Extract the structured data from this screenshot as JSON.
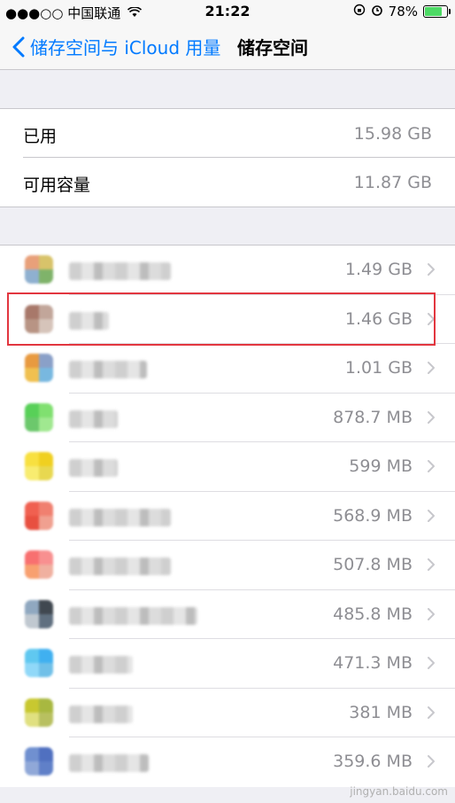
{
  "status_bar": {
    "carrier": "●●●○○ 中国联通",
    "time": "21:22",
    "battery": "78%",
    "battery_level": 0.78
  },
  "nav": {
    "back_label": "储存空间与 iCloud 用量",
    "title": "储存空间"
  },
  "storage_summary": [
    {
      "label": "已用",
      "value": "15.98 GB"
    },
    {
      "label": "可用容量",
      "value": "11.87 GB"
    }
  ],
  "apps": [
    {
      "size": "1.49 GB",
      "colors": [
        "#e8a07a",
        "#d8c36a",
        "#8fb0d0",
        "#7fb36a"
      ]
    },
    {
      "size": "1.46 GB",
      "colors": [
        "#a8786a",
        "#c2a69a",
        "#b89484",
        "#d6c4ba"
      ]
    },
    {
      "size": "1.01 GB",
      "colors": [
        "#e89a40",
        "#8aa0c8",
        "#f0c050",
        "#78b8e0"
      ]
    },
    {
      "size": "878.7 MB",
      "colors": [
        "#58d058",
        "#80e070",
        "#6cc86c",
        "#a0e890"
      ]
    },
    {
      "size": "599 MB",
      "colors": [
        "#f8e040",
        "#f0d020",
        "#f8ec70",
        "#e8d850"
      ]
    },
    {
      "size": "568.9 MB",
      "colors": [
        "#f06050",
        "#f08070",
        "#e85040",
        "#f0a090"
      ]
    },
    {
      "size": "507.8 MB",
      "colors": [
        "#f87070",
        "#f89090",
        "#f8a070",
        "#f0b0a0"
      ]
    },
    {
      "size": "485.8 MB",
      "colors": [
        "#90a8c0",
        "#404850",
        "#c0c8d0",
        "#607080"
      ]
    },
    {
      "size": "471.3 MB",
      "colors": [
        "#60c8f0",
        "#40b0f0",
        "#90d8f8",
        "#70c0e8"
      ]
    },
    {
      "size": "381 MB",
      "colors": [
        "#c8c830",
        "#a8b840",
        "#e0e080",
        "#b8c060"
      ]
    },
    {
      "size": "359.6 MB",
      "colors": [
        "#7090d0",
        "#5070c0",
        "#90a8d8",
        "#6080c8"
      ]
    }
  ],
  "watermark": "jingyan.baidu.com"
}
